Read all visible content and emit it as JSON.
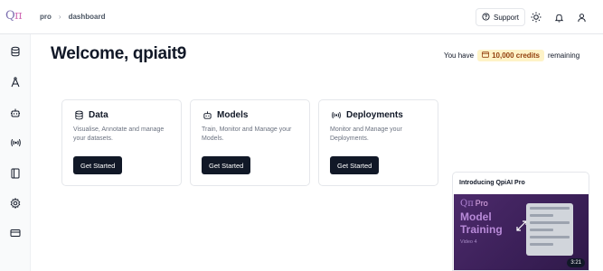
{
  "header": {
    "logo": {
      "q": "Q",
      "pi": "π"
    },
    "breadcrumb": [
      "pro",
      "dashboard"
    ],
    "support_label": "Support"
  },
  "sidebar": {
    "items": [
      {
        "icon": "database-icon"
      },
      {
        "icon": "annotate-icon"
      },
      {
        "icon": "robot-icon"
      },
      {
        "icon": "broadcast-icon"
      },
      {
        "icon": "notebook-icon"
      },
      {
        "icon": "settings-icon"
      },
      {
        "icon": "credit-card-icon"
      }
    ]
  },
  "main": {
    "welcome": "Welcome, qpiait9",
    "credits": {
      "prefix": "You have",
      "amount": "10,000 credits",
      "suffix": "remaining"
    },
    "cards": [
      {
        "title": "Data",
        "icon": "database-icon",
        "description": "Visualise, Annotate and manage your datasets.",
        "button": "Get Started"
      },
      {
        "title": "Models",
        "icon": "robot-icon",
        "description": "Train, Monitor and Manage your Models.",
        "button": "Get Started"
      },
      {
        "title": "Deployments",
        "icon": "broadcast-icon",
        "description": "Monitor and Manage your Deployments.",
        "button": "Get Started"
      }
    ]
  },
  "promo": {
    "title": "Introducing QpiAI Pro",
    "brand_logo": "Qπ",
    "brand_pro": "Pro",
    "headline": "Model Training",
    "video_label": "Video 4",
    "duration": "3:21"
  },
  "colors": {
    "accent_dark": "#111827",
    "credits_bg": "#fef3c7",
    "promo_bg": "#4c2a6b"
  }
}
